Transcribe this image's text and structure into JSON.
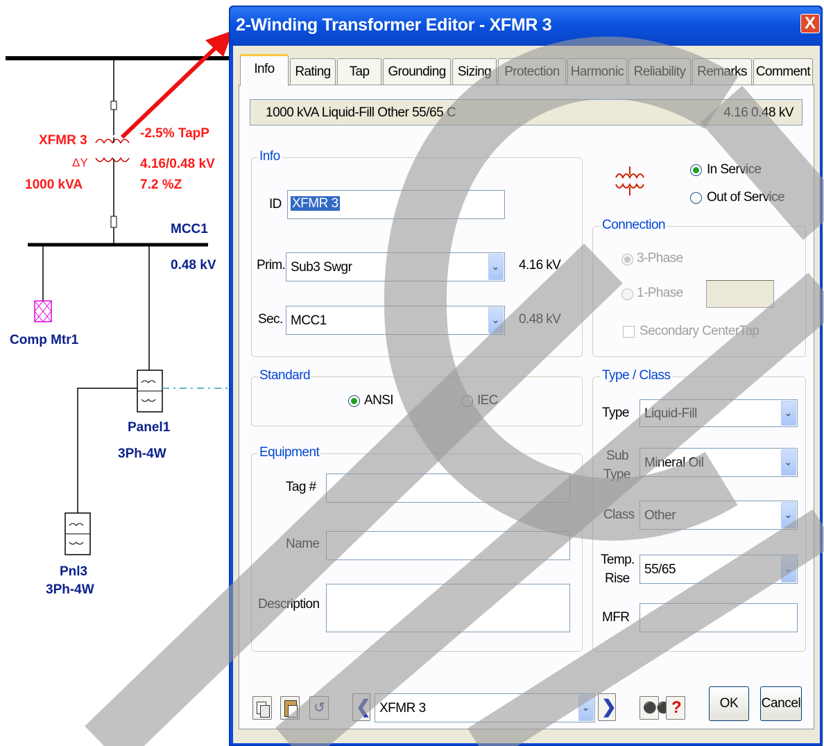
{
  "oneline": {
    "xfmr_name": "XFMR 3",
    "xfmr_conn": "ΔY",
    "xfmr_kva": "1000 kVA",
    "tap": "-2.5% TapP",
    "voltage": "4.16/0.48 kV",
    "impedance": "7.2 %Z",
    "bus_name": "MCC1",
    "bus_kv": "0.48 kV",
    "motor": "Comp Mtr1",
    "panel1_name": "Panel1",
    "panel1_type": "3Ph-4W",
    "panel2_name": "Pnl3",
    "panel2_type": "3Ph-4W"
  },
  "dialog": {
    "title": "2-Winding Transformer Editor - XFMR 3",
    "close_glyph": "X",
    "tabs": [
      "Info",
      "Rating",
      "Tap",
      "Grounding",
      "Sizing",
      "Protection",
      "Harmonic",
      "Reliability",
      "Remarks",
      "Comment"
    ],
    "summary_left": "1000 kVA  Liquid-Fill  Other  55/65 C",
    "summary_right": "4.16   0.48 kV",
    "info_group": {
      "title": "Info",
      "id_label": "ID",
      "id_value": "XFMR 3",
      "prim_label": "Prim.",
      "prim_value": "Sub3 Swgr",
      "prim_kv": "4.16 kV",
      "sec_label": "Sec.",
      "sec_value": "MCC1",
      "sec_kv": "0.48 kV"
    },
    "service": {
      "in_service": "In Service",
      "out_of_service": "Out of Service",
      "selected": "In Service"
    },
    "connection": {
      "title": "Connection",
      "three_phase": "3-Phase",
      "one_phase": "1-Phase",
      "center_tap": "Secondary CenterTap",
      "selected": "3-Phase"
    },
    "standard": {
      "title": "Standard",
      "ansi": "ANSI",
      "iec": "IEC",
      "selected": "ANSI"
    },
    "equipment": {
      "title": "Equipment",
      "tag_label": "Tag #",
      "tag_value": "",
      "name_label": "Name",
      "name_value": "",
      "desc_label": "Description",
      "desc_value": ""
    },
    "type_class": {
      "title": "Type / Class",
      "type_label": "Type",
      "type_value": "Liquid-Fill",
      "subtype_label1": "Sub",
      "subtype_label2": "Type",
      "subtype_value": "Mineral Oil",
      "class_label": "Class",
      "class_value": "Other",
      "temp_label1": "Temp.",
      "temp_label2": "Rise",
      "temp_value": "55/65",
      "mfr_label": "MFR",
      "mfr_value": ""
    },
    "footer": {
      "nav_value": "XFMR 3",
      "ok_label": "OK",
      "cancel_label": "Cancel",
      "help_glyph": "?"
    }
  },
  "colors": {
    "title_bar": "#0b52e0",
    "accent_red": "#ff1a1a",
    "group_title": "#0046d5",
    "bus_label": "#0a1f8c"
  }
}
